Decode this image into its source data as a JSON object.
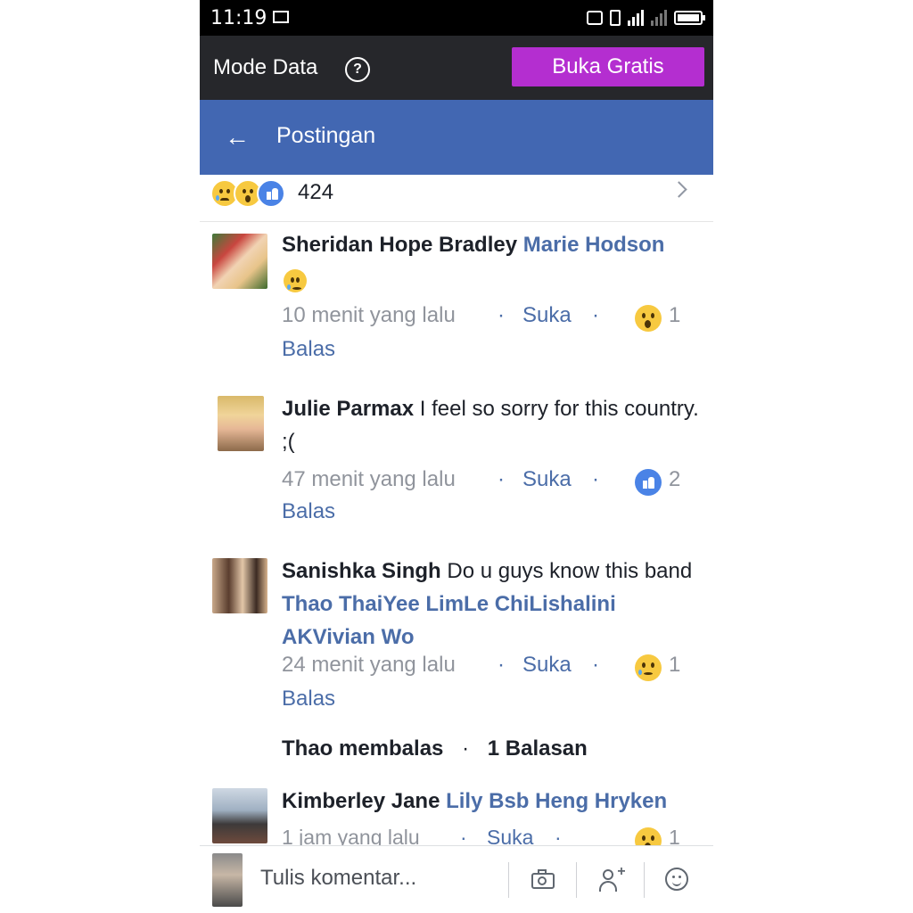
{
  "status_bar": {
    "time": "11:19"
  },
  "data_mode": {
    "label": "Mode Data",
    "help": "?",
    "button": "Buka Gratis"
  },
  "header": {
    "back": "←",
    "title": "Postingan"
  },
  "reactions": {
    "count": "424"
  },
  "comments": [
    {
      "name": "Sheridan Hope Bradley",
      "tag": "Marie Hodson",
      "text": "",
      "time": "10 menit yang lalu",
      "like": "Suka",
      "reaction": "wow",
      "reaction_count": "1",
      "reply": "Balas"
    },
    {
      "name": "Julie Parmax",
      "tag": "",
      "text": "I feel so sorry for this country. ;(",
      "time": "47 menit yang lalu",
      "like": "Suka",
      "reaction": "like",
      "reaction_count": "2",
      "reply": "Balas"
    },
    {
      "name": "Sanishka Singh",
      "text": "Do u guys know this band",
      "tag": "Thao ThaiYee LimLe ChiLishalini AKVivian Wo",
      "time": "24 menit yang lalu",
      "like": "Suka",
      "reaction": "sad",
      "reaction_count": "1",
      "reply": "Balas"
    },
    {
      "name": "Kimberley Jane",
      "tag": "Lily Bsb Heng Hryken",
      "text": "",
      "time": "1 jam yang lalu",
      "like": "Suka",
      "reaction": "wow",
      "reaction_count": "1"
    }
  ],
  "reply_summary": {
    "who": "Thao membalas",
    "dot": "·",
    "count": "1 Balasan"
  },
  "compose": {
    "placeholder": "Tulis komentar..."
  },
  "separator": "·",
  "colors": {
    "header": "#4267b2",
    "data_bar": "#26272b",
    "button": "#b42ed0",
    "link": "#4b6da8"
  }
}
